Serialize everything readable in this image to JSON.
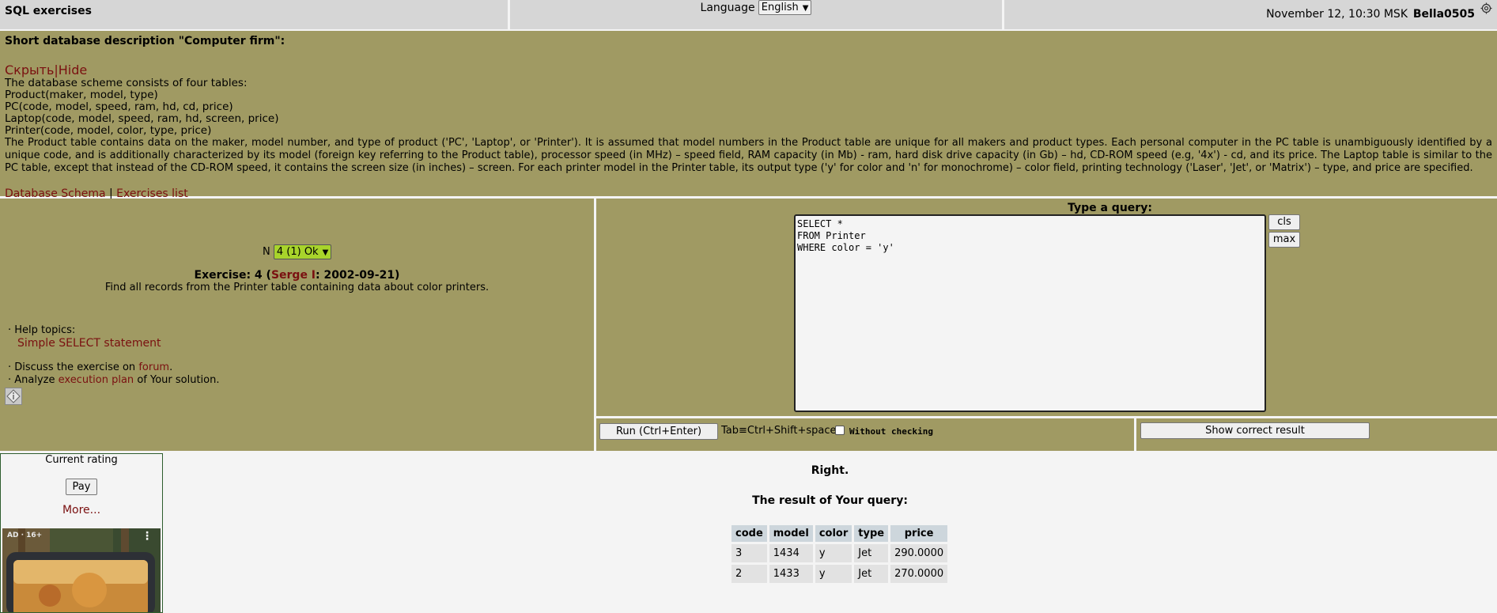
{
  "app": {
    "title": "SQL exercises"
  },
  "header": {
    "language_label": "Language",
    "language_value": "English",
    "datetime": "November 12, 10:30 MSK",
    "username": "Bella0505"
  },
  "description": {
    "title": "Short database description \"Computer firm\":",
    "toggle_ru": "Скрыть",
    "toggle_sep": "|",
    "toggle_en": "Hide",
    "intro": "The database scheme consists of four tables:",
    "tables": [
      "Product(maker, model, type)",
      "PC(code, model, speed, ram, hd, cd, price)",
      "Laptop(code, model, speed, ram, hd, screen, price)",
      "Printer(code, model, color, type, price)"
    ],
    "paragraph": "The Product table contains data on the maker, model number, and type of product ('PC', 'Laptop', or 'Printer'). It is assumed that model numbers in the Product table are unique for all makers and product types. Each personal computer in the PC table is unambiguously identified by a unique code, and is additionally characterized by its model (foreign key referring to the Product table), processor speed (in MHz) – speed field, RAM capacity (in Mb) - ram, hard disk drive capacity (in Gb) – hd, CD-ROM speed (e.g, '4x') - cd, and its price. The Laptop table is similar to the PC table, except that instead of the CD-ROM speed, it contains the screen size (in inches) – screen. For each printer model in the Printer table, its output type ('y' for color and 'n' for monochrome) – color field, printing technology ('Laser', 'Jet', or 'Matrix') – type, and price are specified.",
    "link_schema": "Database Schema",
    "link_sep": "|",
    "link_exercises": "Exercises list"
  },
  "exercise": {
    "n_label": "N",
    "n_value": "4 (1) Ok",
    "title_prefix": "Exercise: 4 (",
    "author": "Serge I",
    "title_suffix": ": 2002-09-21)",
    "text": "Find all records from the Printer table containing data about color printers.",
    "help_label": "· Help topics:",
    "help_link": "Simple SELECT statement",
    "discuss_prefix": "· Discuss the exercise on ",
    "discuss_link": "forum",
    "discuss_suffix": ".",
    "analyze_prefix": "· Analyze ",
    "analyze_link": "execution plan",
    "analyze_suffix": " of Your solution."
  },
  "query": {
    "label": "Type a query:",
    "text": "SELECT *\nFROM Printer\nWHERE color = 'y'",
    "cls_label": "cls",
    "max_label": "max",
    "run_label": "Run (Ctrl+Enter)",
    "tab_hint": "Tab≡Ctrl+Shift+space",
    "without_checking": "Without checking",
    "show_correct": "Show correct result"
  },
  "sidebar": {
    "rating_label": "Current rating",
    "pay_label": "Pay",
    "more_label": "More...",
    "ad_label": "AD · 16+"
  },
  "result": {
    "status": "Right.",
    "title": "The result of Your query:",
    "columns": [
      "code",
      "model",
      "color",
      "type",
      "price"
    ],
    "rows": [
      [
        "3",
        "1434",
        "y",
        "Jet",
        "290.0000"
      ],
      [
        "2",
        "1433",
        "y",
        "Jet",
        "270.0000"
      ]
    ]
  }
}
